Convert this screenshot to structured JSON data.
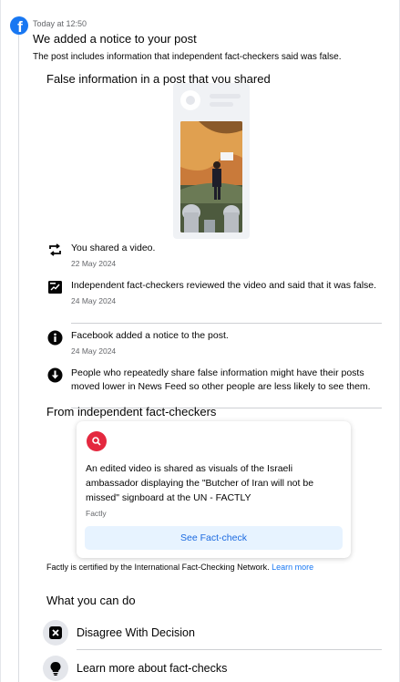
{
  "header": {
    "logo_icon": "facebook-logo-icon",
    "timestamp": "Today at 12:50",
    "title": "We added a notice to your post",
    "subtitle": "The post includes information that independent fact-checkers said was false."
  },
  "post_section": {
    "heading": "False information in a post that you shared"
  },
  "timeline": [
    {
      "icon": "share-repost-icon",
      "text": "You shared a video.",
      "date": "22 May 2024"
    },
    {
      "icon": "flag-review-icon",
      "text": "Independent fact-checkers reviewed the video and said that it was false.",
      "date": "24 May 2024"
    },
    {
      "icon": "info-icon",
      "text": "Facebook added a notice to the post.",
      "date": "24 May 2024"
    },
    {
      "icon": "down-arrow-circle-icon",
      "text": "People who repeatedly share false information might have their posts moved lower in News Feed so other people are less likely to see them.",
      "date": ""
    }
  ],
  "fact_check_section": {
    "heading": "From independent fact-checkers",
    "card": {
      "badge_icon": "factly-logo-icon",
      "headline": "An edited video is shared as visuals of the Israeli ambassador displaying the \"Butcher of Iran will not be missed\" signboard at the UN - FACTLY",
      "source": "Factly",
      "button_label": "See Fact-check"
    },
    "certification_text": "Factly is certified by the International Fact-Checking Network.",
    "learn_more_link": "Learn more"
  },
  "actions": {
    "heading": "What you can do",
    "items": [
      {
        "icon": "close-x-icon",
        "label": "Disagree With Decision"
      },
      {
        "icon": "lightbulb-icon",
        "label": "Learn more about fact-checks"
      }
    ]
  },
  "colors": {
    "facebook_blue": "#1877f2",
    "factly_red": "#e4283f",
    "button_bg": "#e7f3ff",
    "secondary_text": "#65676b"
  }
}
